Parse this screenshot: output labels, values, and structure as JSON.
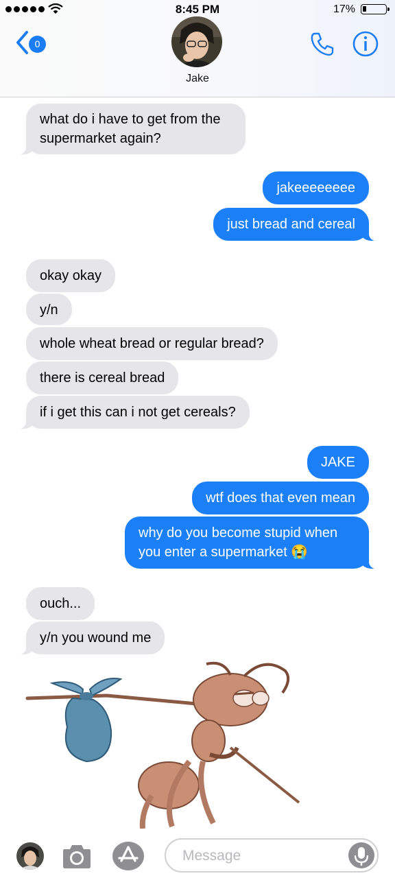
{
  "status_bar": {
    "time": "8:45 PM",
    "battery": "17%",
    "battery_level": 0.17
  },
  "header": {
    "contact_name": "Jake",
    "unread_count": "0"
  },
  "messages": [
    {
      "from": "jake",
      "text": "what do i have to get from the supermarket again?"
    },
    {
      "from": "me",
      "text": "jakeeeeeeee"
    },
    {
      "from": "me",
      "text": "just bread and cereal"
    },
    {
      "from": "jake",
      "text": "okay okay"
    },
    {
      "from": "jake",
      "text": "y/n"
    },
    {
      "from": "jake",
      "text": "whole wheat bread or regular bread?"
    },
    {
      "from": "jake",
      "text": "there is cereal bread"
    },
    {
      "from": "jake",
      "text": "if i get this can i not get cereals?"
    },
    {
      "from": "me",
      "text": "JAKE"
    },
    {
      "from": "me",
      "text": "wtf does that even mean"
    },
    {
      "from": "me",
      "text": "why do you become stupid when you enter a supermarket 😭"
    },
    {
      "from": "jake",
      "text": "ouch..."
    },
    {
      "from": "jake",
      "text": "y/n you wound me"
    }
  ],
  "sticker": {
    "description": "ant-carrying-bindle-sticker"
  },
  "input": {
    "placeholder": "Message",
    "value": ""
  },
  "colors": {
    "outgoing": "#1b80f7",
    "incoming": "#e5e5ea",
    "accent": "#1a7cf6"
  }
}
